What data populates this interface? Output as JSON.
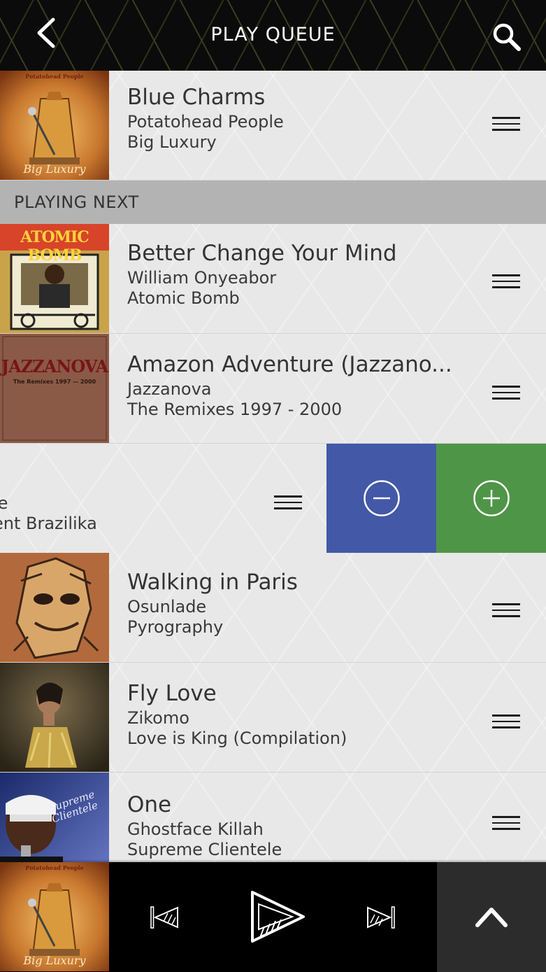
{
  "header": {
    "title": "PLAY QUEUE",
    "back_icon": "chevron-left-icon",
    "search_icon": "search-icon"
  },
  "now_playing": {
    "song": "Blue Charms",
    "artist": "Potatohead People",
    "album": "Big Luxury",
    "cover_text_top": "Potatohead People",
    "cover_text_bottom": "Big Luxury"
  },
  "section_label": "PLAYING NEXT",
  "queue": [
    {
      "song": "Better Change Your Mind",
      "artist": "William Onyeabor",
      "album": "Atomic Bomb",
      "cover_text": "ATOMIC BOMB"
    },
    {
      "song": "Amazon Adventure (Jazzano...",
      "artist": "Jazzanova",
      "album": "The Remixes 1997 - 2000",
      "cover_text": "JAZZANOVA",
      "cover_subtext": "The Remixes 1997 — 2000"
    },
    {
      "song": "",
      "artist": "le",
      "album": "ent Brazilika"
    },
    {
      "song": "Walking in Paris",
      "artist": "Osunlade",
      "album": "Pyrography"
    },
    {
      "song": "Fly Love",
      "artist": "Zikomo",
      "album": "Love is King (Compilation)"
    },
    {
      "song": "One",
      "artist": "Ghostface Killah",
      "album": "Supreme Clientele",
      "cover_text": "Supreme Clientele"
    }
  ],
  "swipe_actions": {
    "remove_icon": "minus-circle-icon",
    "add_icon": "plus-circle-icon",
    "remove_color": "#4359a7",
    "add_color": "#4f9547"
  },
  "player": {
    "cover_text_top": "Potatohead People",
    "cover_text_bottom": "Big Luxury",
    "prev_icon": "skip-previous-icon",
    "play_icon": "play-icon",
    "next_icon": "skip-next-icon",
    "expand_icon": "chevron-up-icon"
  }
}
